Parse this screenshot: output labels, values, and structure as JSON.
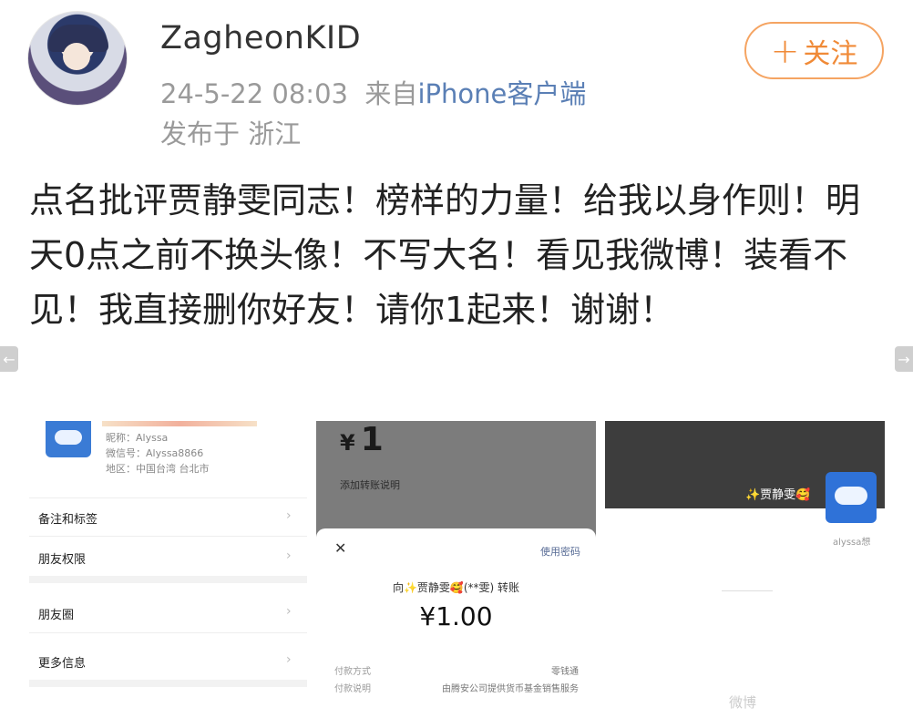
{
  "post": {
    "username": "ZagheonKID",
    "time": "24-5-22 08:03",
    "from_label": "来自",
    "client": "iPhone客户端",
    "location": "发布于 浙江",
    "follow_label": "关注",
    "text": "点名批评贾静雯同志！榜样的力量！给我以身作则！明天0点之前不换头像！不写大名！看见我微博！装看不见！我直接删你好友！请你1起来！谢谢！"
  },
  "icons": {
    "follow_plus": "+",
    "left_arrow": "←",
    "right_arrow": "→",
    "chevron": "›",
    "close": "✕"
  },
  "colors": {
    "follow_accent": "#f08a37",
    "client_link": "#5a7fb5",
    "pay_link": "#576b95"
  },
  "images": {
    "profile": {
      "nickname": "昵称：Alyssa",
      "wechat_id": "微信号：Alyssa8866",
      "region": "地区：中国台湾 台北市",
      "rows": [
        "备注和标签",
        "朋友权限",
        "朋友圈",
        "更多信息"
      ]
    },
    "transfer": {
      "top_amount": "1",
      "currency": "¥",
      "add_note": "添加转账说明",
      "use_password": "使用密码",
      "to_line": "向✨贾静雯🥰(**雯) 转账",
      "amount": "¥1.00",
      "pay_method_label": "付款方式",
      "pay_method_value": "零钱通",
      "pay_note_label": "付款说明",
      "pay_note_value": "由腾安公司提供货币基金销售服务"
    },
    "moments": {
      "display_name": "✨贾静雯🥰",
      "username": "alyssa想"
    }
  },
  "watermark": "微博"
}
